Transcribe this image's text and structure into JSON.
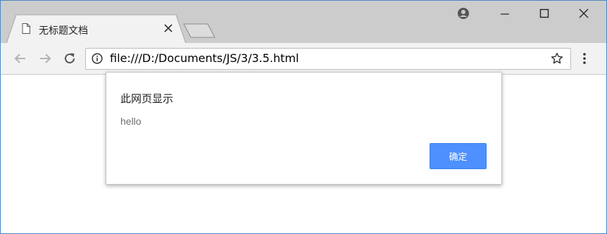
{
  "tab": {
    "title": "无标题文档",
    "icon": "document-icon"
  },
  "address_bar": {
    "url": "file:///D:/Documents/JS/3/3.5.html"
  },
  "dialog": {
    "title": "此网页显示",
    "message": "hello",
    "ok_label": "确定"
  },
  "colors": {
    "accent": "#4d90fe",
    "titlebar": "#cccccc",
    "toolbar": "#f2f2f2",
    "window_border": "#4a86c5"
  }
}
